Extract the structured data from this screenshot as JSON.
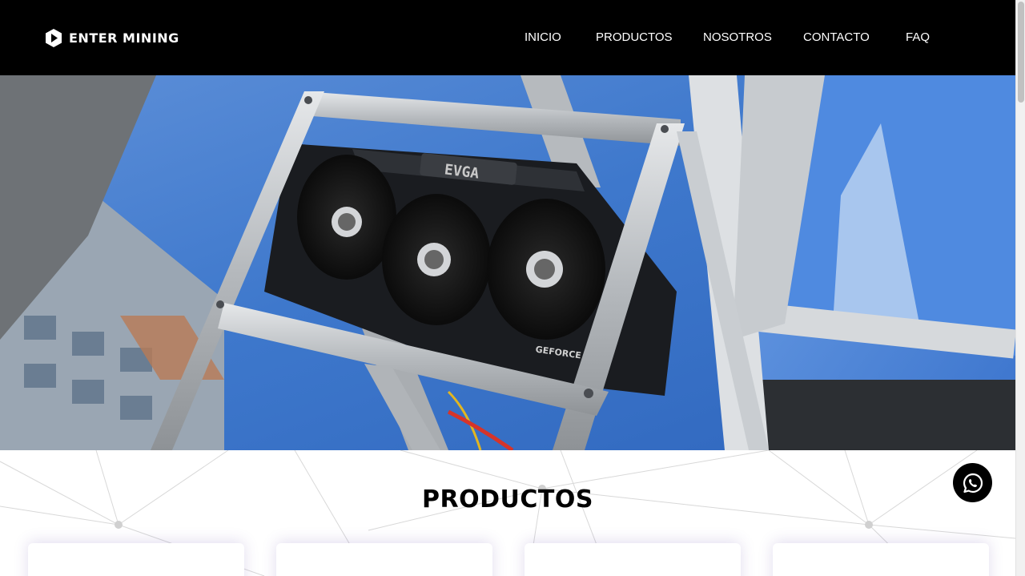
{
  "brand": {
    "name": "ENTER MINING"
  },
  "nav": {
    "links": [
      {
        "label": "INICIO"
      },
      {
        "label": "PRODUCTOS"
      },
      {
        "label": "NOSOTROS"
      },
      {
        "label": "CONTACTO"
      },
      {
        "label": "FAQ"
      }
    ]
  },
  "hero": {
    "gpu_brand": "EVGA",
    "gpu_model": "GEFORCE RTX"
  },
  "products": {
    "title": "PRODUCTOS",
    "card_count": 4
  },
  "colors": {
    "navbar": "#000000",
    "accent": "#000000",
    "sky": "#3e78cc"
  },
  "icons": {
    "whatsapp": "whatsapp-icon",
    "logo": "logo-icon"
  }
}
